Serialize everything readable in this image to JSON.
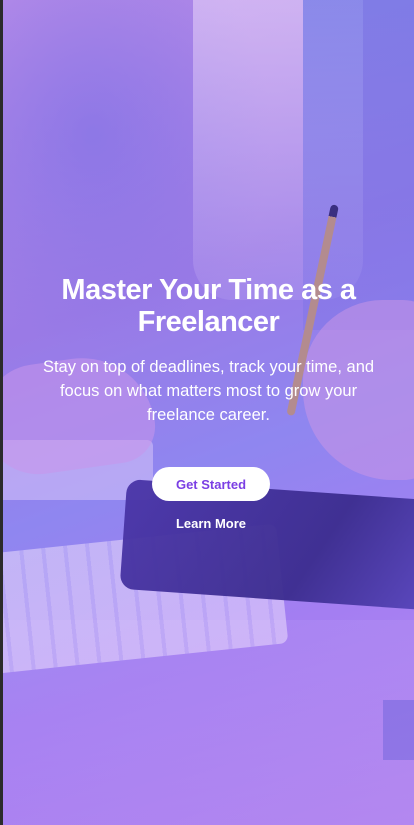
{
  "hero": {
    "title": "Master Your Time as a Freelancer",
    "subtitle": "Stay on top of deadlines, track your time, and focus on what matters most to grow your freelance career."
  },
  "actions": {
    "primary_label": "Get Started",
    "secondary_label": "Learn More"
  },
  "theme": {
    "gradient_start": "#b58be8",
    "gradient_end": "#8f86f0",
    "button_text_color": "#7b3fe4",
    "text_color": "#ffffff"
  }
}
